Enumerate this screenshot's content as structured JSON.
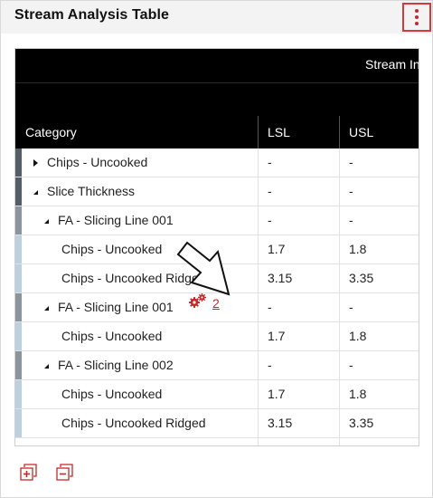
{
  "panel": {
    "title": "Stream Analysis Table"
  },
  "table": {
    "band_title": "Stream In",
    "headers": {
      "category": "Category",
      "lsl": "LSL",
      "usl": "USL"
    },
    "rows": [
      {
        "category": "Chips - Uncooked",
        "lsl": "-",
        "usl": "-",
        "level": 0,
        "toggle": "collapsed",
        "indicator": "#555e66"
      },
      {
        "category": "Slice Thickness",
        "lsl": "-",
        "usl": "-",
        "level": 0,
        "toggle": "expanded",
        "indicator": "#555e66"
      },
      {
        "category": "FA - Slicing Line 001",
        "lsl": "-",
        "usl": "-",
        "level": 1,
        "toggle": "expanded",
        "indicator": "#8a959e"
      },
      {
        "category": "Chips - Uncooked",
        "lsl": "1.7",
        "usl": "1.8",
        "level": 2,
        "toggle": "none",
        "indicator": "#bcd0e0"
      },
      {
        "category": "Chips - Uncooked Ridged",
        "lsl": "3.15",
        "usl": "3.35",
        "level": 2,
        "toggle": "none",
        "indicator": "#bcd0e0"
      },
      {
        "category": "FA - Slicing Line 001",
        "lsl": "-",
        "usl": "-",
        "level": 1,
        "toggle": "expanded",
        "indicator": "#8a959e"
      },
      {
        "category": "Chips - Uncooked",
        "lsl": "1.7",
        "usl": "1.8",
        "level": 2,
        "toggle": "none",
        "indicator": "#bcd0e0"
      },
      {
        "category": "FA - Slicing Line 002",
        "lsl": "-",
        "usl": "-",
        "level": 1,
        "toggle": "expanded",
        "indicator": "#8a959e"
      },
      {
        "category": "Chips - Uncooked",
        "lsl": "1.7",
        "usl": "1.8",
        "level": 2,
        "toggle": "none",
        "indicator": "#bcd0e0"
      },
      {
        "category": "Chips - Uncooked Ridged",
        "lsl": "3.15",
        "usl": "3.35",
        "level": 2,
        "toggle": "none",
        "indicator": "#bcd0e0"
      }
    ]
  },
  "annotation": {
    "icon": "gears-icon",
    "count": "2",
    "color": "#c62828"
  },
  "footer": {
    "expand_icon": "expand-all-icon",
    "collapse_icon": "collapse-all-icon"
  },
  "colors": {
    "accent": "#c62828",
    "header_bg": "#000000",
    "kebab_border": "#d43a3a"
  }
}
